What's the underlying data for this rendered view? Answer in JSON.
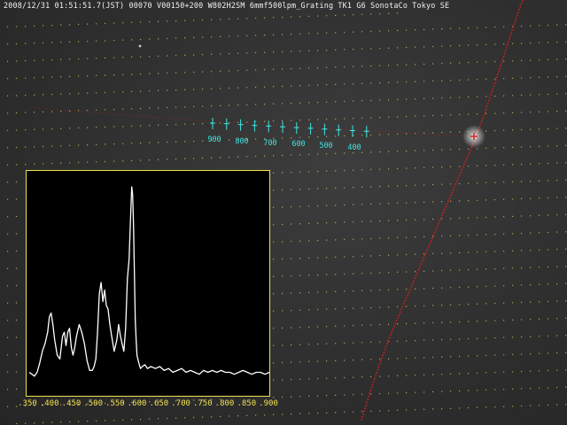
{
  "caption": "2008/12/31 01:51:51.7(JST) 00070 V00150+200 W802H2SM 6mmf500lpm_Grating TK1 G6 SonotaCo Tokyo SE",
  "colors": {
    "caption": "#f2f2f2",
    "grid_dots": "#d8d060",
    "calibration": "#3fe6e6",
    "meteor_trail": "#d02020",
    "inset_border": "#f0e050",
    "spectrum": "#ffffff"
  },
  "calibration_labels": [
    "900",
    "800",
    "700",
    "600",
    "500",
    "400"
  ],
  "chart_data": {
    "type": "line",
    "title": "",
    "xlabel": "",
    "ylabel": "",
    "x_ticks": [
      350,
      400,
      450,
      500,
      550,
      600,
      650,
      700,
      750,
      800,
      850,
      900
    ],
    "x_tick_labels": [
      ".350",
      ".400",
      ".450",
      ".500",
      ".550",
      ".600",
      ".650",
      ".700",
      ".750",
      ".800",
      ".850",
      ".900"
    ],
    "xlim": [
      350,
      900
    ],
    "ylim": [
      0,
      100
    ],
    "x": [
      352,
      358,
      364,
      370,
      376,
      382,
      388,
      394,
      398,
      402,
      406,
      410,
      416,
      422,
      428,
      432,
      436,
      440,
      444,
      448,
      452,
      456,
      460,
      466,
      472,
      478,
      484,
      490,
      496,
      500,
      504,
      508,
      512,
      516,
      520,
      524,
      528,
      532,
      536,
      540,
      546,
      552,
      556,
      560,
      564,
      568,
      572,
      576,
      580,
      584,
      586,
      588,
      590,
      592,
      594,
      596,
      598,
      602,
      606,
      610,
      616,
      622,
      630,
      640,
      650,
      660,
      670,
      680,
      690,
      700,
      710,
      720,
      730,
      740,
      750,
      760,
      770,
      780,
      790,
      800,
      810,
      820,
      830,
      840,
      850,
      860,
      870,
      880,
      890,
      900
    ],
    "y": [
      3,
      2,
      1,
      3,
      8,
      14,
      18,
      24,
      32,
      34,
      28,
      20,
      12,
      10,
      22,
      24,
      17,
      24,
      26,
      16,
      12,
      16,
      22,
      28,
      24,
      18,
      9,
      4,
      4,
      6,
      10,
      24,
      44,
      50,
      40,
      46,
      38,
      36,
      28,
      22,
      14,
      20,
      28,
      22,
      18,
      14,
      26,
      52,
      62,
      88,
      100,
      96,
      80,
      55,
      30,
      20,
      12,
      8,
      5,
      6,
      7,
      5,
      6,
      5,
      6,
      4,
      5,
      3,
      4,
      5,
      3,
      4,
      3,
      2,
      4,
      3,
      4,
      3,
      4,
      3,
      3,
      2,
      3,
      4,
      3,
      2,
      3,
      3,
      2,
      3
    ]
  }
}
